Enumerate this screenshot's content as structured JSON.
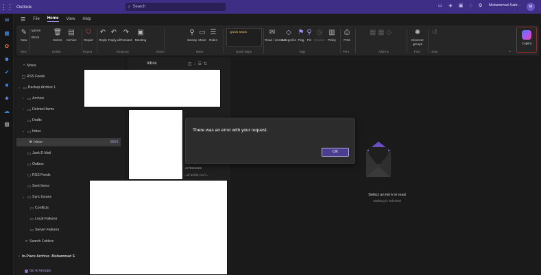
{
  "titlebar": {
    "app_name": "Outlook",
    "search_placeholder": "Search",
    "user_name": "Muhammad Saib...",
    "avatar_initials": "M"
  },
  "tabs": [
    "File",
    "Home",
    "View",
    "Help"
  ],
  "ribbon": {
    "new": "New",
    "ignore": "Ignore",
    "block": "Block",
    "delete": "Delete",
    "archive": "Archive",
    "report": "Report",
    "reply": "Reply",
    "reply_all": "Reply all",
    "forward": "Forward",
    "meeting": "Meeting",
    "sweep": "Sweep",
    "move": "Move",
    "rules": "Rules",
    "quick_steps": "Quick steps",
    "read_unread": "Read / Unread",
    "categorize": "Categorize",
    "flag": "Flag",
    "pin": "Pin",
    "snooze": "Snooze",
    "policy": "Policy",
    "print": "Print",
    "discover_groups": "Discover groups",
    "undo": "Undo",
    "copilot": "Copilot",
    "group_new": "New",
    "group_delete": "Delete",
    "group_respond": "Respond",
    "group_move": "Move",
    "group_quick_steps": "Quick steps",
    "group_tags": "Tags",
    "group_print": "Print",
    "group_addins": "Add-ins",
    "group_find": "Find",
    "group_undo": "Undo"
  },
  "folders": {
    "notes": "Notes",
    "rss_feeds_top": "RSS Feeds",
    "backup_archive": "Backup Archive 1",
    "archive": "Archive",
    "deleted_items": "Deleted Items",
    "drafts": "Drafts",
    "inbox_parent": "Inbox",
    "inbox_child": "Inbox",
    "inbox_count": "5564",
    "junk": "Junk E-Mail",
    "outbox": "Outbox",
    "rss_feeds": "RSS Feeds",
    "sent_items": "Sent Items",
    "sync_issues": "Sync Issues",
    "conflicts": "Conflicts",
    "local_failures": "Local Failures",
    "server_failures": "Server Failures",
    "search_folders": "Search Folders",
    "in_place_archive": "In-Place Archive -Muhammad S",
    "go_to_groups": "Go to Groups"
  },
  "message_list": {
    "header": "Inbox",
    "date": "27/06/2025",
    "preview": "...ull assist you f..."
  },
  "reading_pane": {
    "select_label": "Select an item to read",
    "sub_label": "Nothing is selected"
  },
  "dialog": {
    "message": "There was an error with your request.",
    "ok_label": "OK"
  },
  "colors": {
    "titlebar": "#3f2e86",
    "accent": "#a88bf5",
    "ok_button": "#4b3e90"
  }
}
